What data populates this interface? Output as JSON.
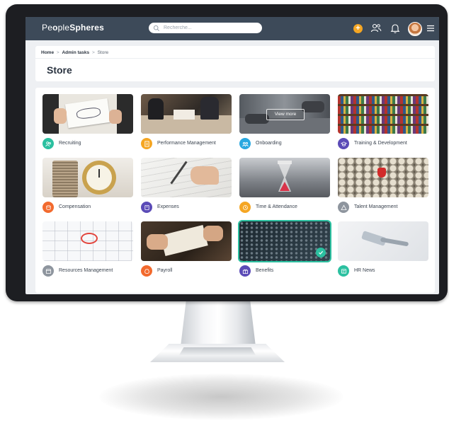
{
  "app": {
    "brand_pre": "Pe",
    "brand_mid": "ple",
    "brand_post": "Spheres",
    "brand_bold_glyph": "o"
  },
  "search": {
    "placeholder": "Recherche..."
  },
  "topbar": {
    "add_label": "+"
  },
  "breadcrumb": {
    "home": "Home",
    "admin": "Admin tasks",
    "current": "Store",
    "separator": ">"
  },
  "page": {
    "title": "Store"
  },
  "tiles": [
    {
      "label": "Recruiting",
      "color": "#2bc0a0",
      "icon": "people-icon"
    },
    {
      "label": "Performance Management",
      "color": "#f5a623",
      "icon": "document-icon"
    },
    {
      "label": "Onboarding",
      "color": "#29a8e0",
      "icon": "users-icon",
      "overlay": "View more"
    },
    {
      "label": "Training & Development",
      "color": "#5b4bb7",
      "icon": "cap-icon"
    },
    {
      "label": "Compensation",
      "color": "#f26a2e",
      "icon": "coins-icon"
    },
    {
      "label": "Expenses",
      "color": "#5b4bb7",
      "icon": "receipt-icon"
    },
    {
      "label": "Time & Attendance",
      "color": "#f5a623",
      "icon": "clock-icon"
    },
    {
      "label": "Talent Management",
      "color": "#8e959e",
      "icon": "triangle-icon"
    },
    {
      "label": "Resources Management",
      "color": "#8e959e",
      "icon": "calendar-icon"
    },
    {
      "label": "Payroll",
      "color": "#f26a2e",
      "icon": "money-icon"
    },
    {
      "label": "Benefits",
      "color": "#5b4bb7",
      "icon": "gift-icon",
      "selected": true
    },
    {
      "label": "HR News",
      "color": "#2bc0a0",
      "icon": "news-icon"
    }
  ],
  "colors": {
    "topbar": "#3d4a59",
    "accent_green": "#2bc0a0",
    "accent_orange": "#f5a623"
  }
}
